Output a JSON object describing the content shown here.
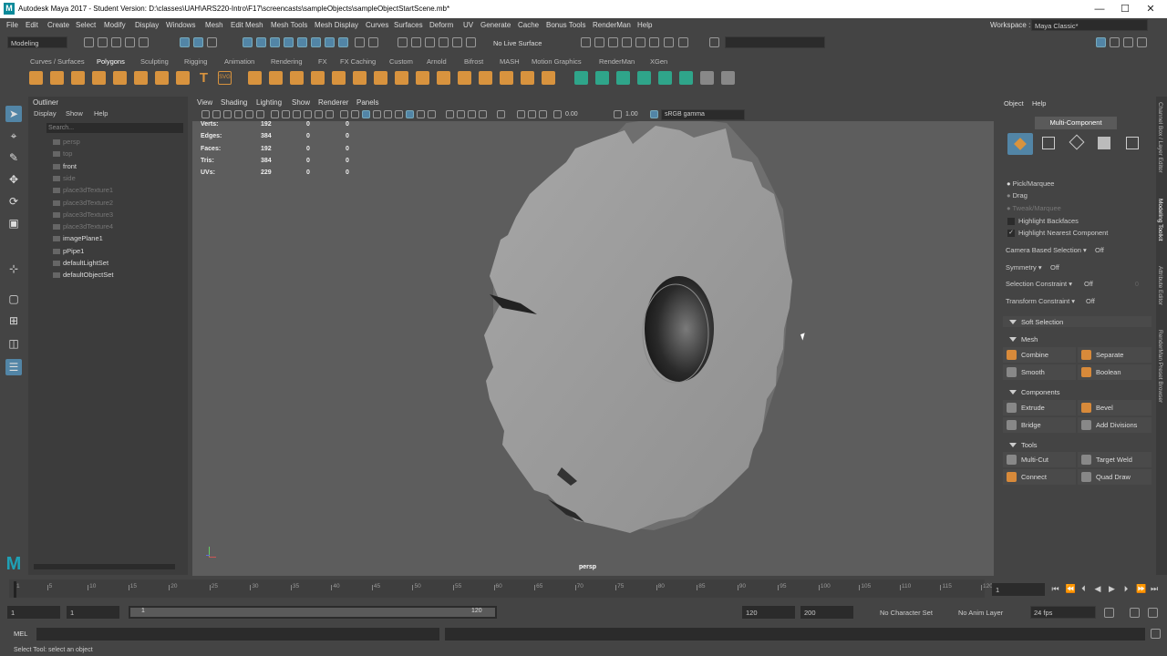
{
  "window": {
    "logo": "M",
    "title": "Autodesk Maya 2017 - Student Version: D:\\classes\\UAH\\ARS220-Intro\\F17\\screencasts\\sampleObjects\\sampleObjectStartScene.mb*",
    "minimize": "—",
    "maximize": "☐",
    "close": "✕"
  },
  "menubar": {
    "items": [
      "File",
      "Edit",
      "Create",
      "Select",
      "Modify",
      "Display",
      "Windows",
      "Mesh",
      "Edit Mesh",
      "Mesh Tools",
      "Mesh Display",
      "Curves",
      "Surfaces",
      "Deform",
      "UV",
      "Generate",
      "Cache",
      "Bonus Tools",
      "RenderMan",
      "Help"
    ],
    "workspace_label": "Workspace :",
    "workspace_value": "Maya Classic*"
  },
  "statusline": {
    "mode": "Modeling",
    "live_surface": "No Live Surface"
  },
  "shelf": {
    "tabs": [
      "Curves / Surfaces",
      "Polygons",
      "Sculpting",
      "Rigging",
      "Animation",
      "Rendering",
      "FX",
      "FX Caching",
      "Custom",
      "Arnold",
      "Bifrost",
      "MASH",
      "Motion Graphics",
      "RenderMan",
      "XGen"
    ],
    "active_tab": "Polygons",
    "text_icon": "T",
    "svg_icon": "SVG"
  },
  "outliner": {
    "title": "Outliner",
    "menus": [
      "Display",
      "Show",
      "Help"
    ],
    "search_placeholder": "Search...",
    "items": [
      {
        "label": "persp",
        "dim": true
      },
      {
        "label": "top",
        "dim": true
      },
      {
        "label": "front",
        "dim": false
      },
      {
        "label": "side",
        "dim": true
      },
      {
        "label": "place3dTexture1",
        "dim": true
      },
      {
        "label": "place3dTexture2",
        "dim": true
      },
      {
        "label": "place3dTexture3",
        "dim": true
      },
      {
        "label": "place3dTexture4",
        "dim": true
      },
      {
        "label": "imagePlane1",
        "dim": false
      },
      {
        "label": "pPipe1",
        "dim": false
      },
      {
        "label": "defaultLightSet",
        "dim": false
      },
      {
        "label": "defaultObjectSet",
        "dim": false
      }
    ]
  },
  "viewport": {
    "menus": [
      "View",
      "Shading",
      "Lighting",
      "Show",
      "Renderer",
      "Panels"
    ],
    "exposure": "0.00",
    "gamma": "1.00",
    "color_space": "sRGB gamma",
    "camera": "persp",
    "hud": [
      {
        "label": "Verts:",
        "a": "192",
        "b": "0",
        "c": "0"
      },
      {
        "label": "Edges:",
        "a": "384",
        "b": "0",
        "c": "0"
      },
      {
        "label": "Faces:",
        "a": "192",
        "b": "0",
        "c": "0"
      },
      {
        "label": "Tris:",
        "a": "384",
        "b": "0",
        "c": "0"
      },
      {
        "label": "UVs:",
        "a": "229",
        "b": "0",
        "c": "0"
      }
    ]
  },
  "modeling_toolkit": {
    "menus": [
      "Object",
      "Help"
    ],
    "mode_button": "Multi-Component",
    "options": {
      "pick_marquee": "Pick/Marquee",
      "drag": "Drag",
      "tweak_marquee": "Tweak/Marquee",
      "highlight_backfaces": "Highlight Backfaces",
      "highlight_nearest": "Highlight Nearest Component",
      "check": "✓"
    },
    "settings": [
      {
        "label": "Camera Based Selection",
        "value": "Off"
      },
      {
        "label": "Symmetry",
        "value": "Off"
      },
      {
        "label": "Selection Constraint",
        "value": "Off"
      },
      {
        "label": "Transform Constraint",
        "value": "Off"
      }
    ],
    "constraint_zero": "0",
    "soft_selection": "Soft Selection",
    "sections": {
      "mesh": "Mesh",
      "components": "Components",
      "tools": "Tools"
    },
    "buttons": {
      "combine": "Combine",
      "separate": "Separate",
      "smooth": "Smooth",
      "boolean": "Boolean",
      "extrude": "Extrude",
      "bevel": "Bevel",
      "bridge": "Bridge",
      "add_divisions": "Add Divisions",
      "multi_cut": "Multi-Cut",
      "target_weld": "Target Weld",
      "connect": "Connect",
      "quad_draw": "Quad Draw"
    },
    "side_tabs": [
      "Channel Box / Layer Editor",
      "Modeling Toolkit",
      "Attribute Editor",
      "RenderMan Preset Browser"
    ]
  },
  "timeline": {
    "ticks": [
      "1",
      "5",
      "10",
      "15",
      "20",
      "25",
      "30",
      "35",
      "40",
      "45",
      "50",
      "55",
      "60",
      "65",
      "70",
      "75",
      "80",
      "85",
      "90",
      "95",
      "100",
      "105",
      "110",
      "115",
      "120"
    ],
    "current_frame": "1",
    "playback": [
      "⏮",
      "⏪",
      "⏴",
      "◀",
      "▶",
      "⏵",
      "⏩",
      "⏭"
    ]
  },
  "range": {
    "start": "1",
    "anim_start": "1",
    "slider_start": "1",
    "slider_end": "120",
    "anim_end": "120",
    "end": "200",
    "character_set": "No Character Set",
    "anim_layer": "No Anim Layer",
    "fps": "24 fps"
  },
  "mel": {
    "label": "MEL"
  },
  "help_line": "Select Tool: select an object"
}
